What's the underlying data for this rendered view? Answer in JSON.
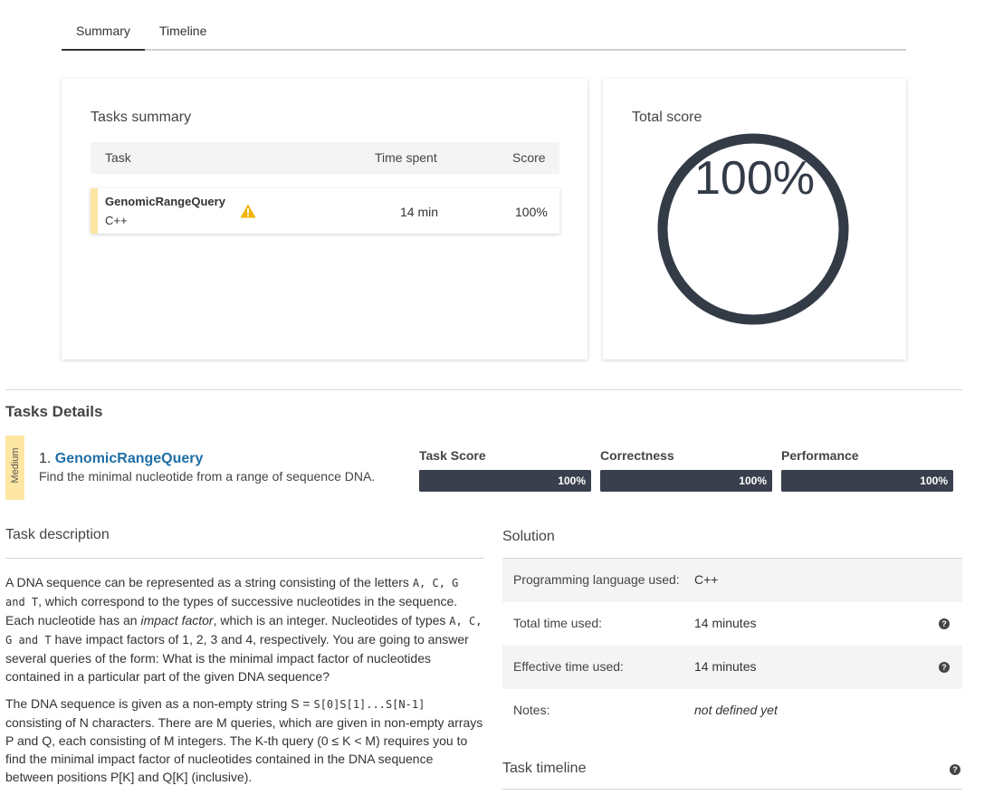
{
  "tabs": [
    {
      "label": "Summary",
      "active": true
    },
    {
      "label": "Timeline",
      "active": false
    }
  ],
  "tasks_summary": {
    "title": "Tasks summary",
    "columns": [
      "Task",
      "Time spent",
      "Score"
    ],
    "rows": [
      {
        "name": "GenomicRangeQuery",
        "language": "C++",
        "time": "14 min",
        "score": "100%",
        "icon": "warning-icon"
      }
    ]
  },
  "total_score": {
    "title": "Total score",
    "value": "100%",
    "fraction": 1.0,
    "ring_color": "#333b47"
  },
  "details": {
    "title": "Tasks Details",
    "difficulty": "Medium",
    "task_number": "1.",
    "task_name": "GenomicRangeQuery",
    "task_subtitle": "Find the minimal nucleotide from a range of sequence DNA.",
    "metrics": [
      {
        "label": "Task Score",
        "value": "100%",
        "fraction": 1.0
      },
      {
        "label": "Correctness",
        "value": "100%",
        "fraction": 1.0
      },
      {
        "label": "Performance",
        "value": "100%",
        "fraction": 1.0
      }
    ]
  },
  "description": {
    "title": "Task description",
    "p1": {
      "a": "A DNA sequence can be represented as a string consisting of the letters ",
      "b": ", which correspond to the types of successive nucleotides in the sequence. Each nucleotide has an ",
      "c": "impact factor",
      "d": ", which is an integer. Nucleotides of types ",
      "e": " have impact factors of 1, 2, 3 and 4, respectively. You are going to answer several queries of the form: What is the minimal impact factor of nucleotides contained in a particular part of the given DNA sequence?",
      "letters_list": "A, C, G and T",
      "letters_list2": "A, C, G and T"
    },
    "p2": {
      "a": "The DNA sequence is given as a non-empty string S = ",
      "code": "S[0]S[1]...S[N-1]",
      "b": " consisting of N characters. There are M queries, which are given in non-empty arrays P and Q, each consisting of M integers. The K-th query (0 ≤ K < M) requires you to find the minimal impact factor of nucleotides contained in the DNA sequence between positions P[K] and Q[K] (inclusive)."
    }
  },
  "solution": {
    "title": "Solution",
    "rows": [
      {
        "key": "Programming language used:",
        "value": "C++",
        "help": false
      },
      {
        "key": "Total time used:",
        "value": "14 minutes",
        "help": true
      },
      {
        "key": "Effective time used:",
        "value": "14 minutes",
        "help": true
      },
      {
        "key": "Notes:",
        "value": "not defined yet",
        "help": false
      }
    ],
    "help_glyph": "?"
  },
  "timeline": {
    "title": "Task timeline",
    "help_glyph": "?"
  }
}
